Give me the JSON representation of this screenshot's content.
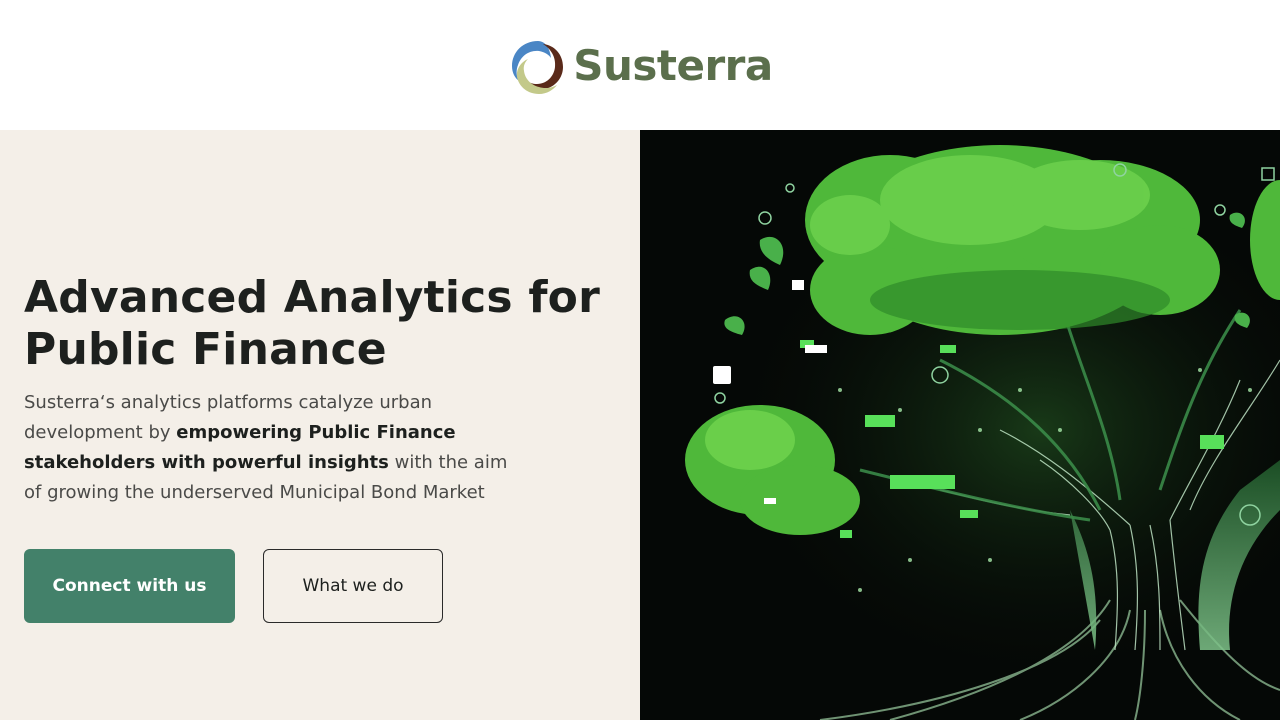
{
  "header": {
    "brand_name": "Susterra",
    "logo_icon": "swirl-logo-icon",
    "brand_color": "#5b6f4c"
  },
  "hero": {
    "title_line1": "Advanced Analytics for",
    "title_line2": "Public Finance",
    "description": {
      "part1": "Susterra‘s analytics platforms catalyze urban development by ",
      "bold": "empowering Public Finance stakeholders with powerful insights",
      "part2": " with the aim of growing the underserved Municipal Bond Market"
    },
    "primary_button": "Connect with us",
    "secondary_button": "What we do",
    "image": "digital-circuit-tree-image"
  },
  "colors": {
    "left_panel_bg": "#f4efe8",
    "primary_button_bg": "#43816a",
    "heading": "#1d201e",
    "image_bg": "#050806",
    "foliage": "#4fb83a"
  }
}
